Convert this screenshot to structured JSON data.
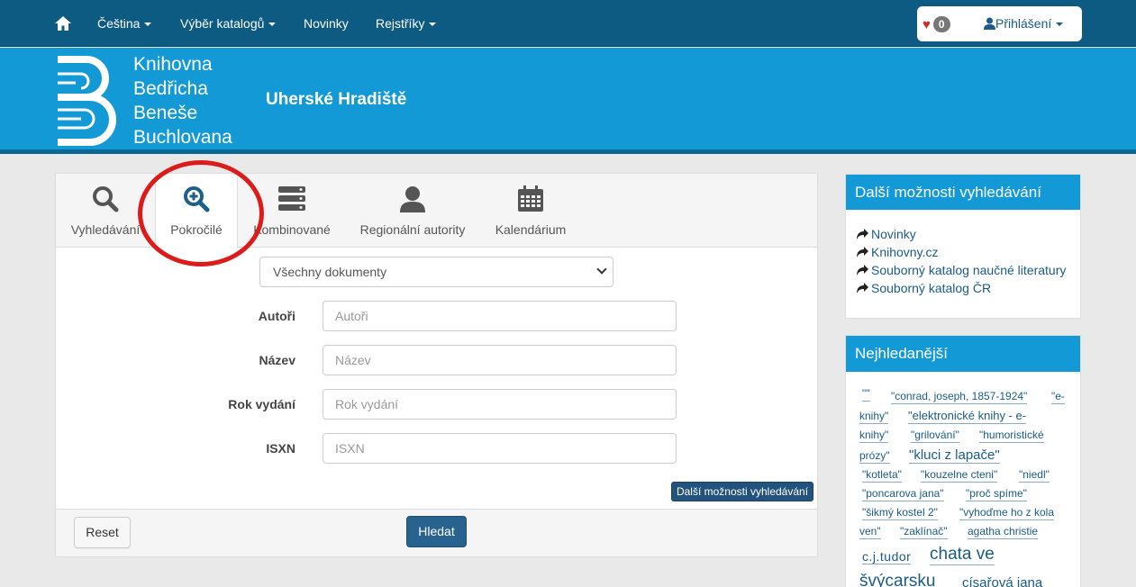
{
  "navbar": {
    "language_label": "Čeština",
    "catalog_label": "Výběr katalogů",
    "news_label": "Novinky",
    "registers_label": "Rejstříky",
    "favorites_count": "0",
    "login_label": "Přihlášení"
  },
  "header": {
    "logo_lines": [
      "Knihovna",
      "Bedřicha",
      "Beneše",
      "Buchlovana"
    ],
    "city": "Uherské Hradiště"
  },
  "tabs": [
    {
      "label": "Vyhledávání",
      "icon": "search-icon"
    },
    {
      "label": "Pokročilé",
      "icon": "search-plus-icon"
    },
    {
      "label": "Kombinované",
      "icon": "server-icon"
    },
    {
      "label": "Regionální autority",
      "icon": "user-icon"
    },
    {
      "label": "Kalendárium",
      "icon": "calendar-icon"
    }
  ],
  "form": {
    "doc_type": "Všechny dokumenty",
    "fields": [
      {
        "label": "Autoři",
        "placeholder": "Autoři"
      },
      {
        "label": "Název",
        "placeholder": "Název"
      },
      {
        "label": "Rok vydání",
        "placeholder": "Rok vydání"
      },
      {
        "label": "ISXN",
        "placeholder": "ISXN"
      }
    ],
    "more_label": "Další možnosti vyhledávání",
    "reset_label": "Reset",
    "search_label": "Hledat"
  },
  "sidebar": {
    "more_title": "Další možnosti vyhledávání",
    "links": [
      "Novinky",
      "Knihovny.cz",
      "Souborný katalog naučné literatury",
      "Souborný katalog ČR"
    ],
    "popular_title": "Nejhledanější",
    "tags": [
      "\"\"",
      "\"conrad, joseph, 1857-1924\"",
      "\"e-",
      "knihy\"",
      "\"elektronické knihy - e-",
      "knihy\"",
      "\"grilování\"",
      "\"humoristické",
      "prózy\"",
      "\"kluci z lapače\"",
      "\"kotleta\"",
      "\"kouzelne cteni\"",
      "\"niedl\"",
      "\"poncarova jana\"",
      "\"proč spíme\"",
      "\"šikmý kostel 2\"",
      "\"vyhoďme ho z kola",
      "ven\"",
      "\"zaklínač\"",
      "agatha christie",
      "c.j.tudor",
      "chata ve",
      "švýcarsku",
      "císařová jana"
    ]
  },
  "colors": {
    "navbar": "#0d5a82",
    "banner": "#139ad6",
    "accent_circle": "#dc1b1b"
  }
}
